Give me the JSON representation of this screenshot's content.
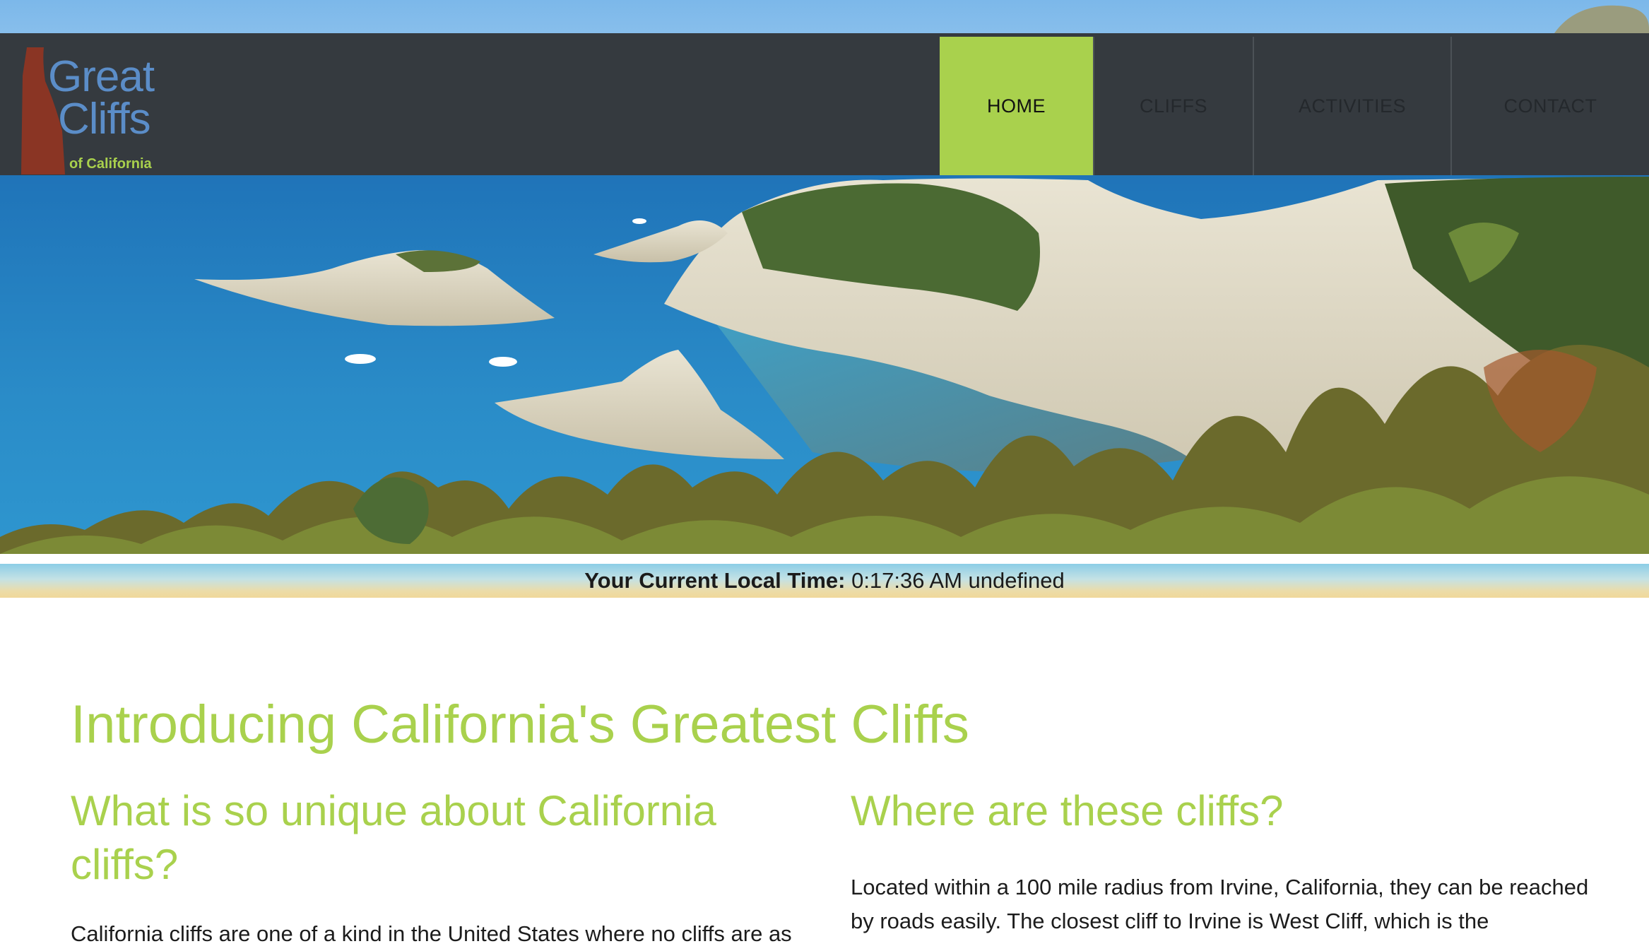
{
  "header": {
    "logo": {
      "line1": "Great",
      "line2": "Cliffs",
      "sub": "of California"
    },
    "nav": [
      {
        "label": "HOME",
        "active": true
      },
      {
        "label": "CLIFFS",
        "active": false
      },
      {
        "label": "ACTIVITIES",
        "active": false
      },
      {
        "label": "CONTACT",
        "active": false
      }
    ]
  },
  "timebar": {
    "label": "Your Current Local Time:",
    "value": "0:17:36 AM undefined"
  },
  "main": {
    "title": "Introducing California's Greatest Cliffs",
    "left": {
      "heading": "What is so unique about California cliffs?",
      "text": "California cliffs are one of a kind in the United States where no cliffs are as"
    },
    "right": {
      "heading": "Where are these cliffs?",
      "text": "Located within a 100 mile radius from Irvine, California, they can be reached by roads easily. The closest cliff to Irvine is West Cliff, which is the"
    }
  },
  "colors": {
    "accent": "#a9d14d",
    "header_bg": "#353a3f",
    "logo_blue": "#5b8dc8",
    "logo_red": "#8a3524"
  }
}
